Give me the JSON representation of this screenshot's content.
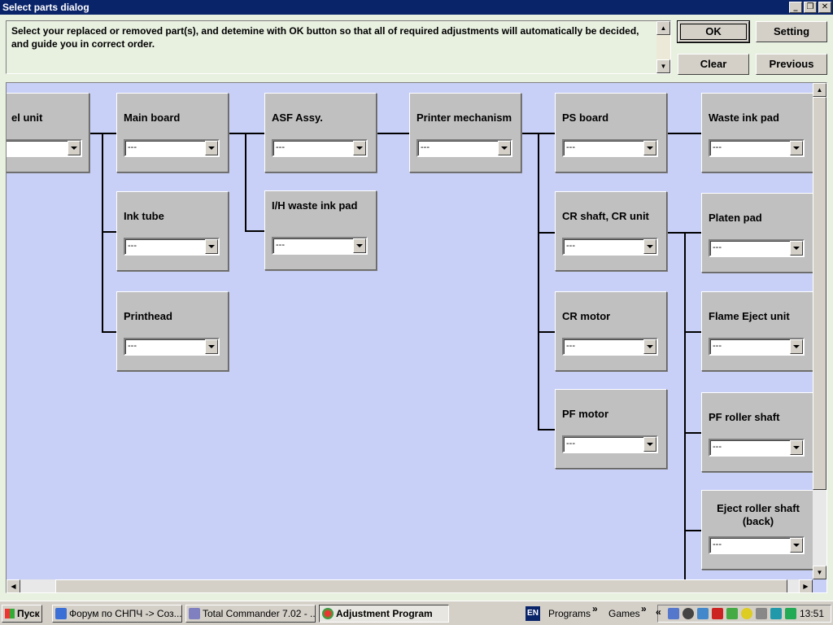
{
  "window": {
    "title": "Select parts dialog",
    "min": "_",
    "max": "❐",
    "close": "✕"
  },
  "instruction": "Select your replaced or removed part(s), and detemine with OK button so that all of required adjustments will automatically be decided, and guide you in correct order.",
  "buttons": {
    "ok": "OK",
    "setting": "Setting",
    "clear": "Clear",
    "previous": "Previous"
  },
  "parts": {
    "panel_unit": {
      "label": "el unit",
      "value": ""
    },
    "main_board": {
      "label": "Main board",
      "value": "---"
    },
    "ink_tube": {
      "label": "Ink tube",
      "value": "---"
    },
    "printhead": {
      "label": "Printhead",
      "value": "---"
    },
    "asf_assy": {
      "label": "ASF Assy.",
      "value": "---"
    },
    "ih_waste_ink_pad": {
      "label": "I/H waste ink pad",
      "value": "---"
    },
    "printer_mechanism": {
      "label": "Printer mechanism",
      "value": "---"
    },
    "ps_board": {
      "label": "PS board",
      "value": "---"
    },
    "cr_shaft": {
      "label": "CR shaft, CR unit",
      "value": "---"
    },
    "cr_motor": {
      "label": "CR motor",
      "value": "---"
    },
    "pf_motor": {
      "label": "PF motor",
      "value": "---"
    },
    "waste_ink_pad": {
      "label": "Waste ink pad",
      "value": "---"
    },
    "platen_pad": {
      "label": "Platen pad",
      "value": "---"
    },
    "flame_eject": {
      "label": "Flame Eject unit",
      "value": "---"
    },
    "pf_roller": {
      "label": "PF roller shaft",
      "value": "---"
    },
    "eject_roller": {
      "label": "Eject roller shaft (back)",
      "value": "---"
    }
  },
  "taskbar": {
    "start": "Пуск",
    "tasks": [
      "Форум по СНПЧ -> Соз...",
      "Total Commander 7.02 - ...",
      "Adjustment Program"
    ],
    "lang": "EN",
    "toolbars": [
      "Programs",
      "Games"
    ],
    "clock": "13:51"
  }
}
